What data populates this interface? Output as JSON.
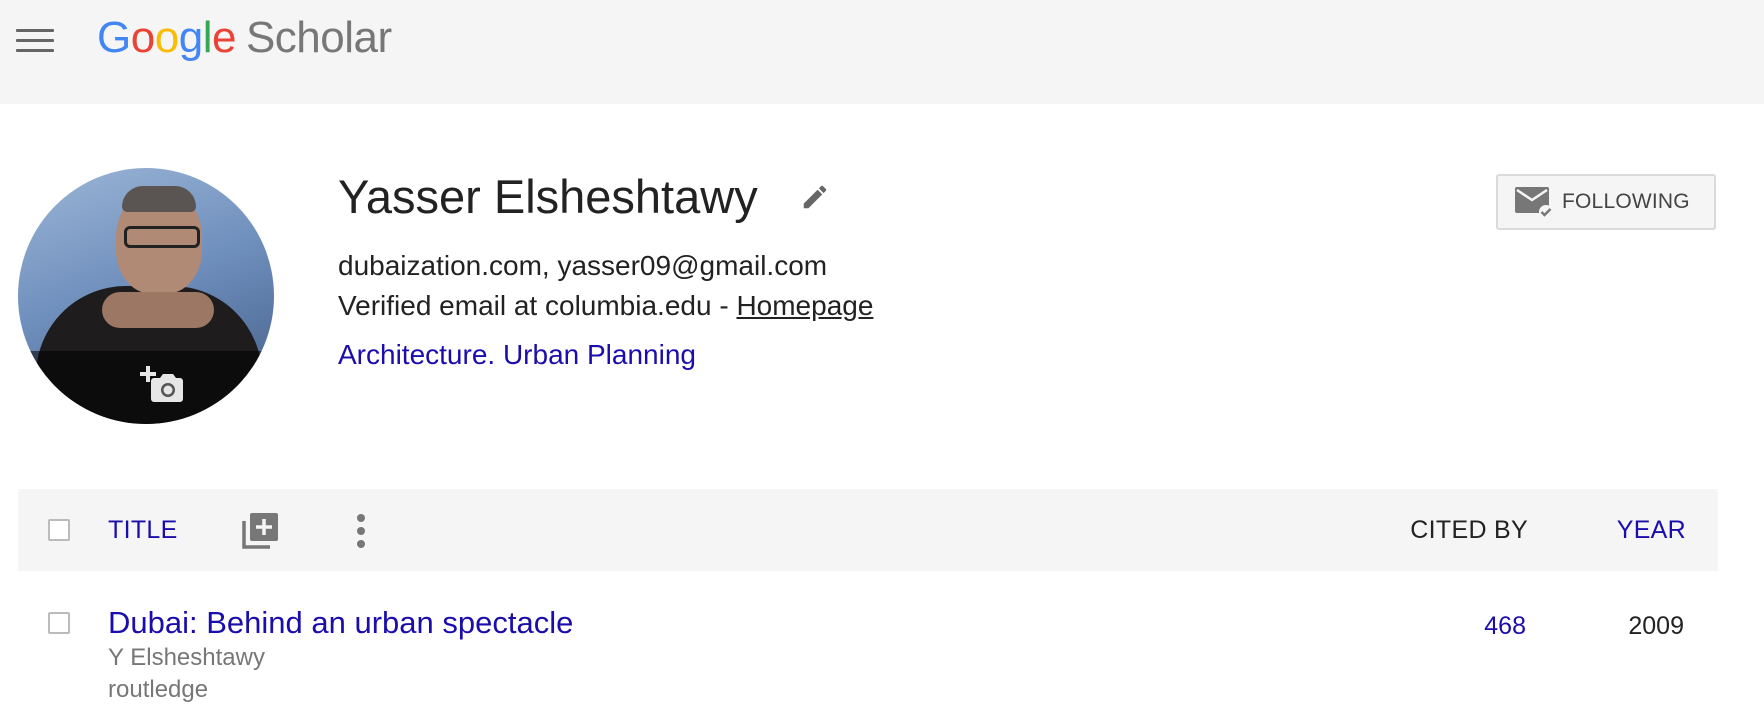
{
  "header": {
    "logo": {
      "letters": [
        "G",
        "o",
        "o",
        "g",
        "l",
        "e"
      ],
      "product": "Scholar"
    },
    "menu_icon": "hamburger-menu-icon"
  },
  "profile": {
    "name": "Yasser Elsheshtawy",
    "affiliation": "dubaization.com, yasser09@gmail.com",
    "verified_prefix": "Verified email at columbia.edu - ",
    "homepage_label": "Homepage",
    "interests": "Architecture. Urban Planning",
    "follow_label": "FOLLOWING"
  },
  "table": {
    "headers": {
      "title": "TITLE",
      "cited_by": "CITED BY",
      "year": "YEAR"
    },
    "rows": [
      {
        "title": "Dubai: Behind an urban spectacle",
        "authors": "Y Elsheshtawy",
        "venue": "routledge",
        "cited_by": "468",
        "year": "2009"
      }
    ]
  },
  "colors": {
    "link": "#1a0dab",
    "topbar_bg": "#f5f5f5",
    "google_blue": "#4285F4",
    "google_red": "#EA4335",
    "google_yellow": "#FBBC05",
    "google_green": "#34A853"
  }
}
